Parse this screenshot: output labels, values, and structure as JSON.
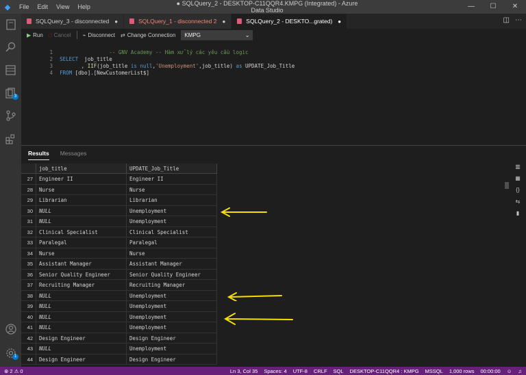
{
  "window": {
    "title": "● SQLQuery_2 - DESKTOP-C11QQR4.KMPG (Integrated) - Azure Data Studio",
    "menu": [
      "File",
      "Edit",
      "View",
      "Help"
    ],
    "controls": [
      "—",
      "☐",
      "✕"
    ]
  },
  "tabs": [
    {
      "label": "SQLQuery_3 - disconnected",
      "marker": "●"
    },
    {
      "label": "SQLQuery_1 - disconnected 2",
      "marker": "●"
    },
    {
      "label": "SQLQuery_2 - DESKTO...grated)",
      "marker": "●"
    }
  ],
  "toolbar": {
    "run": "Run",
    "cancel": "Cancel",
    "disconnect": "Disconnect",
    "change_connection": "Change Connection",
    "connection": "KMPG"
  },
  "activity_badges": {
    "git": "3",
    "settings": "1"
  },
  "editor": {
    "lines": [
      {
        "num": "1",
        "text": "                -- GNV Academy -- Hàm xử lý các yêu cầu logic"
      },
      {
        "num": "2",
        "kw": "SELECT",
        "text": "  job_title"
      },
      {
        "num": "3",
        "text": "       , IIF(job_title is null,'Unemployment',job_title) as UPDATE_Job_Title"
      },
      {
        "num": "4",
        "kw": "FROM",
        "text": " [dbo].[NewCustomerList$]"
      }
    ],
    "line3": {
      "prefix": "       , ",
      "fn": "IIF",
      "open": "(",
      "col": "job_title ",
      "is_null": "is null",
      "comma": ",",
      "str": "'Unemployment'",
      "rest": ",job_title) ",
      "as_kw": "as",
      "alias": " UPDATE_Job_Title"
    }
  },
  "results": {
    "tabs": [
      "Results",
      "Messages"
    ],
    "columns": [
      "job_title",
      "UPDATE_Job_Title"
    ],
    "rows": [
      {
        "n": "27",
        "a": "Engineer II",
        "b": "Engineer II"
      },
      {
        "n": "28",
        "a": "Nurse",
        "b": "Nurse"
      },
      {
        "n": "29",
        "a": "Librarian",
        "b": "Librarian"
      },
      {
        "n": "30",
        "a": "NULL",
        "b": "Unemployment"
      },
      {
        "n": "31",
        "a": "NULL",
        "b": "Unemployment"
      },
      {
        "n": "32",
        "a": "Clinical Specialist",
        "b": "Clinical Specialist"
      },
      {
        "n": "33",
        "a": "Paralegal",
        "b": "Paralegal"
      },
      {
        "n": "34",
        "a": "Nurse",
        "b": "Nurse"
      },
      {
        "n": "35",
        "a": "Assistant Manager",
        "b": "Assistant Manager"
      },
      {
        "n": "36",
        "a": "Senior Quality Engineer",
        "b": "Senior Quality Engineer"
      },
      {
        "n": "37",
        "a": "Recruiting Manager",
        "b": "Recruiting Manager"
      },
      {
        "n": "38",
        "a": "NULL",
        "b": "Unemployment"
      },
      {
        "n": "39",
        "a": "NULL",
        "b": "Unemployment"
      },
      {
        "n": "40",
        "a": "NULL",
        "b": "Unemployment"
      },
      {
        "n": "41",
        "a": "NULL",
        "b": "Unemployment"
      },
      {
        "n": "42",
        "a": "Design Engineer",
        "b": "Design Engineer"
      },
      {
        "n": "43",
        "a": "NULL",
        "b": "Unemployment"
      },
      {
        "n": "44",
        "a": "Design Engineer",
        "b": "Design Engineer"
      }
    ]
  },
  "annotation_color": "#f5e000",
  "status": {
    "problems": "⊗ 2 ⚠ 0",
    "position": "Ln 3, Col 35",
    "spaces": "Spaces: 4",
    "encoding": "UTF-8",
    "eol": "CRLF",
    "language": "SQL",
    "server": "DESKTOP-C11QQR4 : KMPG",
    "dialect": "MSSQL",
    "rows": "1,000 rows",
    "time": "00:00:00"
  }
}
